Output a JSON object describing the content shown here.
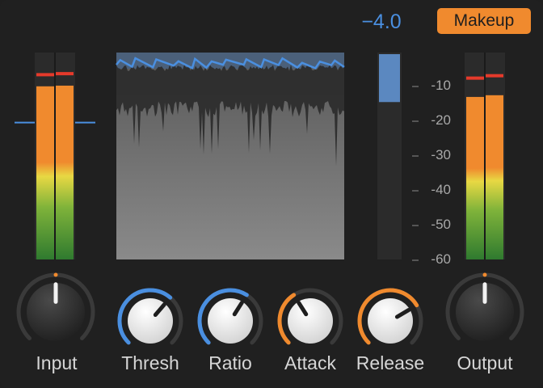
{
  "gain_reduction": {
    "value": "−4.0",
    "level_db": -4.0
  },
  "makeup_button": {
    "label": "Makeup",
    "active": true
  },
  "scale": {
    "ticks": [
      "-10",
      "-20",
      "-30",
      "-40",
      "-50",
      "-60"
    ],
    "range_db": [
      0,
      -60
    ]
  },
  "input_meter": {
    "left_level_db": -9.4,
    "right_level_db": -9.2,
    "left_peak_db": -6.0,
    "right_peak_db": -5.7,
    "threshold_db": -20.0
  },
  "output_meter": {
    "left_level_db": -12.5,
    "right_level_db": -12.0,
    "left_peak_db": -7.0,
    "right_peak_db": -6.3
  },
  "knobs": [
    {
      "id": "input",
      "label": "Input",
      "value": 0.5,
      "style": "big-dark",
      "accent": "#f08a2e"
    },
    {
      "id": "thresh",
      "label": "Thresh",
      "value": 0.65,
      "style": "light",
      "accent": "#4a8fe0"
    },
    {
      "id": "ratio",
      "label": "Ratio",
      "value": 0.62,
      "style": "light",
      "accent": "#4a8fe0"
    },
    {
      "id": "attack",
      "label": "Attack",
      "value": 0.38,
      "style": "light",
      "accent": "#f08a2e"
    },
    {
      "id": "release",
      "label": "Release",
      "value": 0.72,
      "style": "light",
      "accent": "#f08a2e"
    },
    {
      "id": "output",
      "label": "Output",
      "value": 0.5,
      "style": "big-dark",
      "accent": "#f08a2e"
    }
  ],
  "colors": {
    "accent_orange": "#f08a2e",
    "accent_blue": "#4a8fe0",
    "peak_red": "#e53a2b",
    "background": "#202020"
  }
}
